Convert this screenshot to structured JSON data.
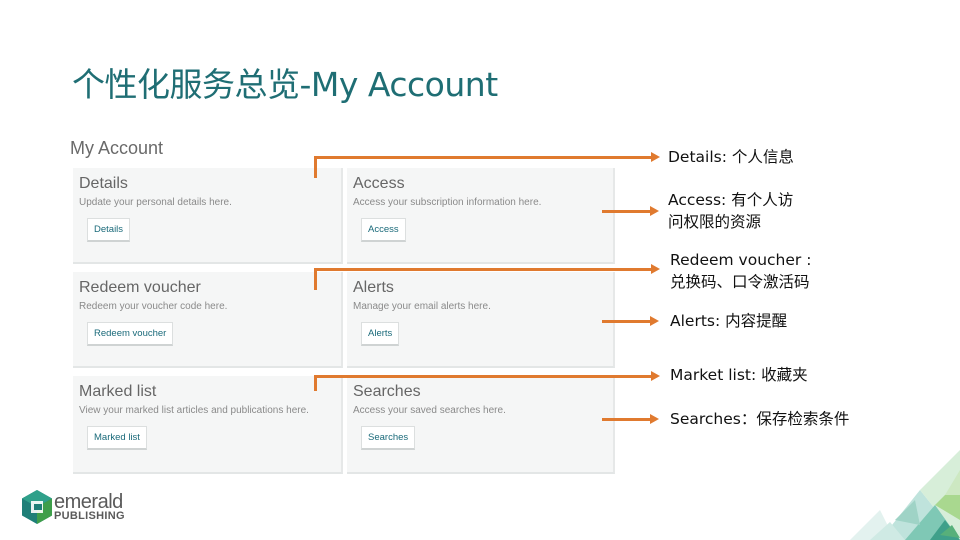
{
  "slide": {
    "title": "个性化服务总览-My Account"
  },
  "screenshot": {
    "title": "My Account",
    "cards": [
      {
        "title": "Details",
        "description": "Update your personal details here.",
        "button": "Details"
      },
      {
        "title": "Access",
        "description": "Access your subscription information here.",
        "button": "Access"
      },
      {
        "title": "Redeem voucher",
        "description": "Redeem your voucher code here.",
        "button": "Redeem voucher"
      },
      {
        "title": "Alerts",
        "description": "Manage your email alerts here.",
        "button": "Alerts"
      },
      {
        "title": "Marked list",
        "description": "View your marked list articles and publications here.",
        "button": "Marked list"
      },
      {
        "title": "Searches",
        "description": "Access your saved searches here.",
        "button": "Searches"
      }
    ]
  },
  "annotations": [
    {
      "line1": "Details: 个人信息",
      "line2": ""
    },
    {
      "line1": "Access: 有个人访",
      "line2": "问权限的资源"
    },
    {
      "line1": "Redeem voucher :",
      "line2": "兑换码、口令激活码"
    },
    {
      "line1": "Alerts: 内容提醒",
      "line2": ""
    },
    {
      "line1": "Market list: 收藏夹",
      "line2": ""
    },
    {
      "line1": "Searches：保存检索条件",
      "line2": ""
    }
  ],
  "logo": {
    "name": "emerald",
    "subtitle": "PUBLISHING"
  },
  "colors": {
    "title": "#1f6e74",
    "arrow": "#e07a2f",
    "button_text": "#1a6a7a",
    "logo_teal": "#1f7f78",
    "logo_green": "#3e9e4a"
  }
}
